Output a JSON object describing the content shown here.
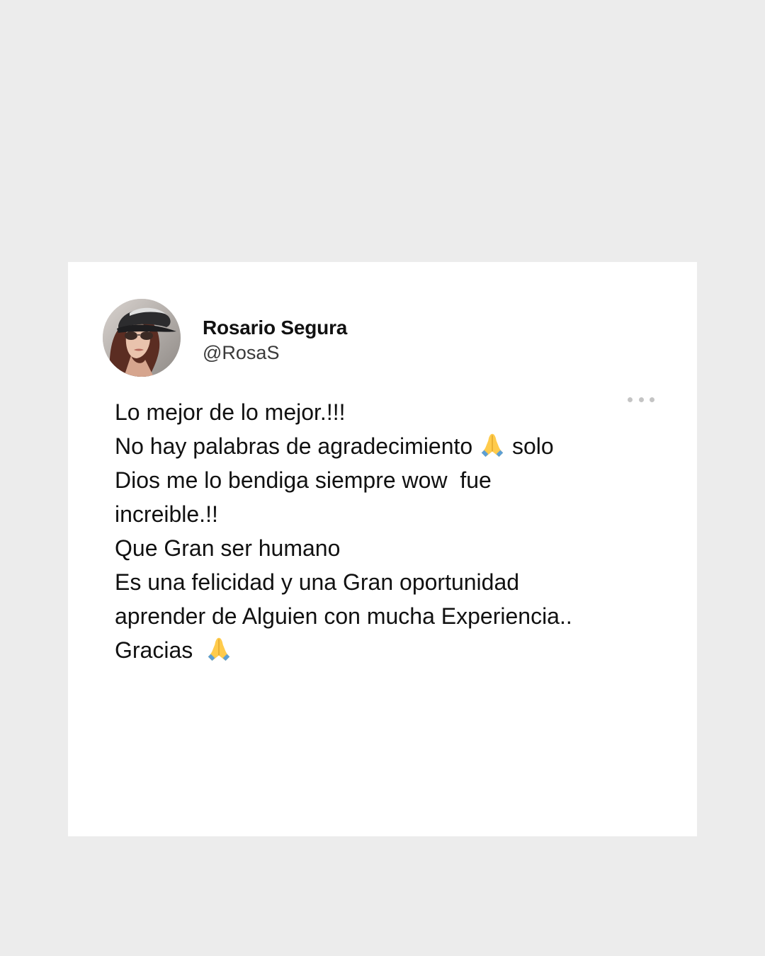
{
  "post": {
    "display_name": "Rosario Segura",
    "handle": "@RosaS",
    "more_icon": "more-options-icon",
    "lines": [
      {
        "before": "Lo mejor de lo mejor.!!!"
      },
      {
        "before": "No hay palabras de agradecimiento ",
        "emoji": "folded-hands-icon",
        "after": " solo"
      },
      {
        "before": "Dios me lo bendiga siempre wow  fue"
      },
      {
        "before": "increible.!!"
      },
      {
        "before": "Que Gran ser humano"
      },
      {
        "before": "Es una felicidad y una Gran oportunidad"
      },
      {
        "before": "aprender de Alguien con mucha Experiencia.."
      },
      {
        "before": "Gracias  ",
        "emoji": "folded-hands-icon",
        "after": ""
      }
    ]
  },
  "colors": {
    "background": "#ececec",
    "card": "#ffffff",
    "text": "#111111",
    "muted": "#c4c4c4"
  }
}
